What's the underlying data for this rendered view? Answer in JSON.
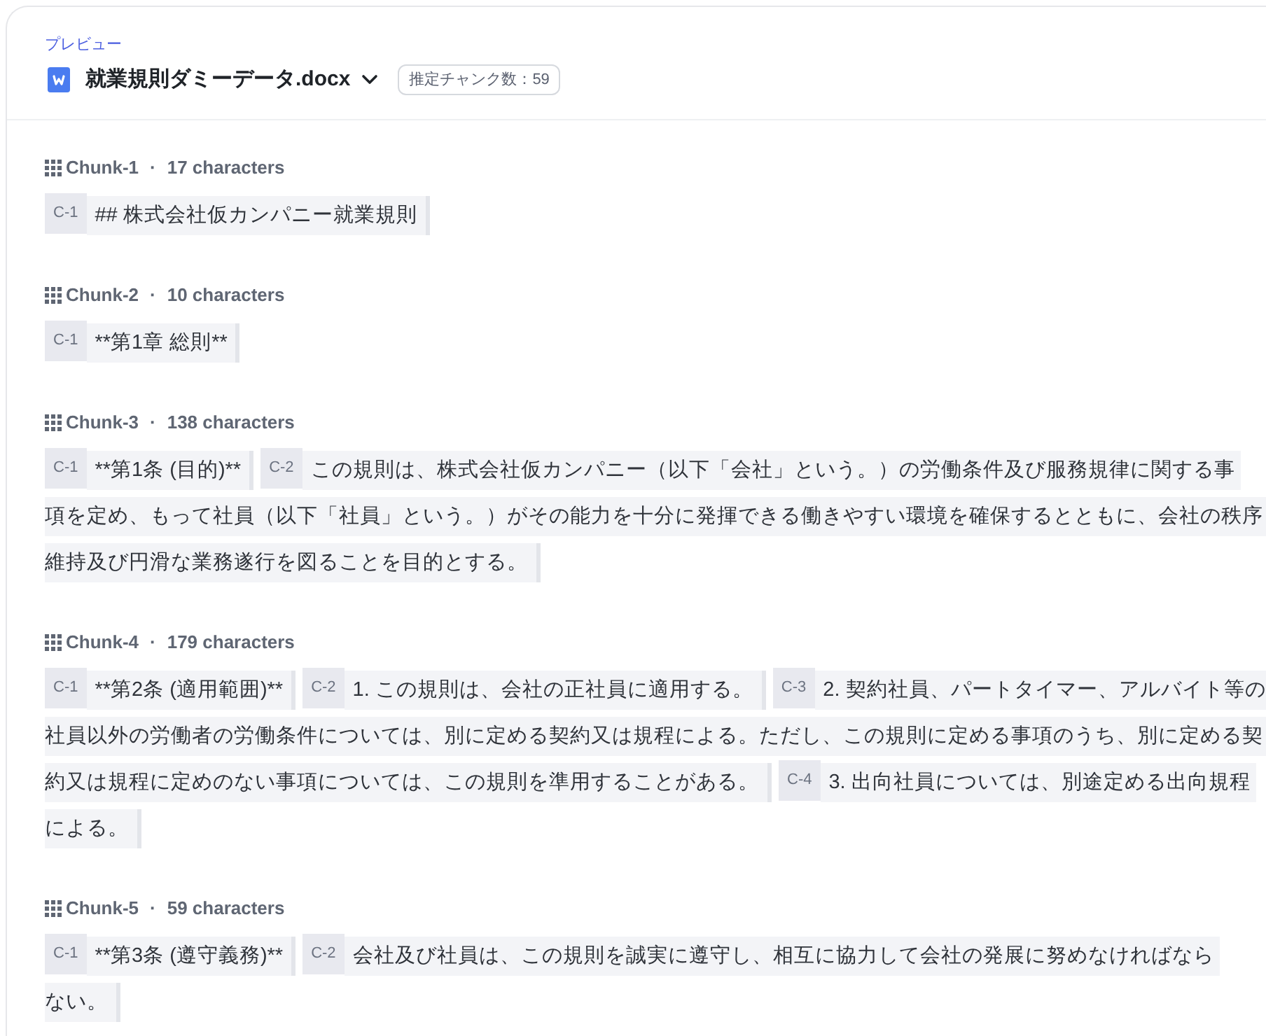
{
  "preview": {
    "label": "プレビュー",
    "file_name": "就業規則ダミーデータ.docx",
    "chunk_count_badge": "推定チャンク数：59"
  },
  "chunks": [
    {
      "title": "Chunk-1",
      "separator": "·",
      "count": "17 characters",
      "segments": [
        {
          "tag": "C-1",
          "lines": [
            "## 株式会社仮カンパニー就業規則"
          ]
        }
      ]
    },
    {
      "title": "Chunk-2",
      "separator": "·",
      "count": "10 characters",
      "segments": [
        {
          "tag": "C-1",
          "lines": [
            "**第1章 総則**"
          ]
        }
      ]
    },
    {
      "title": "Chunk-3",
      "separator": "·",
      "count": "138 characters",
      "segments": [
        {
          "tag": "C-1",
          "lines": [
            "**第1条 (目的)**"
          ]
        },
        {
          "tag": "C-2",
          "lines": [
            "この規則は、株式会社仮カンパニー（以下「会社」という。）の労働条件及び服務規律に関する事",
            "項を定め、もって社員（以下「社員」という。）がその能力を十分に発揮できる働きやすい環境を確保するとともに、会社の秩序",
            "維持及び円滑な業務遂行を図ることを目的とする。"
          ]
        }
      ]
    },
    {
      "title": "Chunk-4",
      "separator": "·",
      "count": "179 characters",
      "segments": [
        {
          "tag": "C-1",
          "lines": [
            "**第2条 (適用範囲)**"
          ]
        },
        {
          "tag": "C-2",
          "lines": [
            "1. この規則は、会社の正社員に適用する。"
          ]
        },
        {
          "tag": "C-3",
          "lines": [
            "2. 契約社員、パートタイマー、アルバイト等の",
            "社員以外の労働者の労働条件については、別に定める契約又は規程による。ただし、この規則に定める事項のうち、別に定める契",
            "約又は規程に定めのない事項については、この規則を準用することがある。"
          ]
        },
        {
          "tag": "C-4",
          "lines": [
            "3. 出向社員については、別途定める出向規程",
            "による。"
          ]
        }
      ]
    },
    {
      "title": "Chunk-5",
      "separator": "·",
      "count": "59 characters",
      "segments": [
        {
          "tag": "C-1",
          "lines": [
            "**第3条 (遵守義務)**"
          ]
        },
        {
          "tag": "C-2",
          "lines": [
            "会社及び社員は、この規則を誠実に遵守し、相互に協力して会社の発展に努めなければなら",
            "ない。"
          ]
        }
      ]
    }
  ]
}
